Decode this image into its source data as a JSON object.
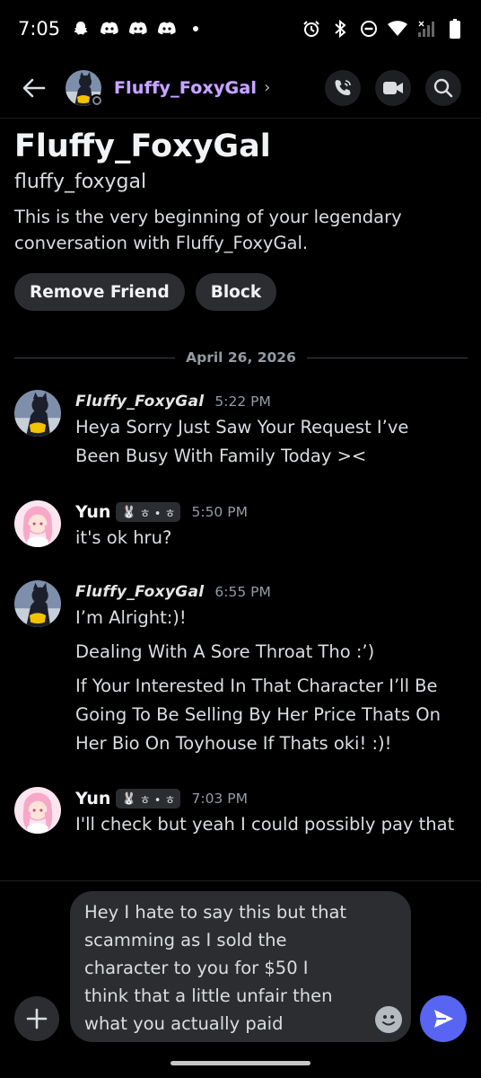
{
  "status_bar": {
    "time": "7:05",
    "left_icons": [
      "snapchat-icon",
      "discord-icon",
      "discord-icon",
      "discord-icon",
      "dot-icon"
    ],
    "right_icons": [
      "alarm-icon",
      "bluetooth-icon",
      "do-not-disturb-icon",
      "wifi-icon",
      "signal-icon",
      "battery-icon"
    ]
  },
  "header": {
    "username": "Fluffy_FoxyGal",
    "chevron": "›",
    "actions": [
      "phone-call-icon",
      "video-call-icon",
      "search-icon"
    ],
    "accent_color": "#c9a6ff"
  },
  "intro": {
    "display_name": "Fluffy_FoxyGal",
    "handle": "fluffy_foxygal",
    "description": "This is the very beginning of your legendary conversation with Fluffy_FoxyGal.",
    "buttons": {
      "remove_friend": "Remove Friend",
      "block": "Block"
    }
  },
  "date_divider": "April 26, 2026",
  "messages": [
    {
      "author": "Fluffy_FoxyGal",
      "time": "5:22 PM",
      "lines": [
        "Heya Sorry Just Saw Your Request I’ve",
        "Been Busy With Family Today ><"
      ]
    },
    {
      "author": "Yun",
      "tag": "ㅎ • ㅎ",
      "time": "5:50 PM",
      "lines": [
        "it's ok hru?"
      ]
    },
    {
      "author": "Fluffy_FoxyGal",
      "time": "6:55 PM",
      "lines": [
        "I’m Alright:)!",
        "Dealing With A Sore Throat Tho :’)",
        "If Your Interested In That Character I’ll Be",
        "Going To Be Selling By Her Price Thats On",
        "Her Bio On Toyhouse If Thats oki! :)!"
      ]
    },
    {
      "author": "Yun",
      "tag": "ㅎ • ㅎ",
      "time": "7:03 PM",
      "lines": [
        "I'll check but yeah I could possibly pay that"
      ]
    }
  ],
  "composer": {
    "text": "Hey I hate to say this but that\nscamming as I sold the\ncharacter to you for $50 I\nthink that a little unfair then\nwhat you actually paid",
    "send_color": "#5865f2"
  }
}
